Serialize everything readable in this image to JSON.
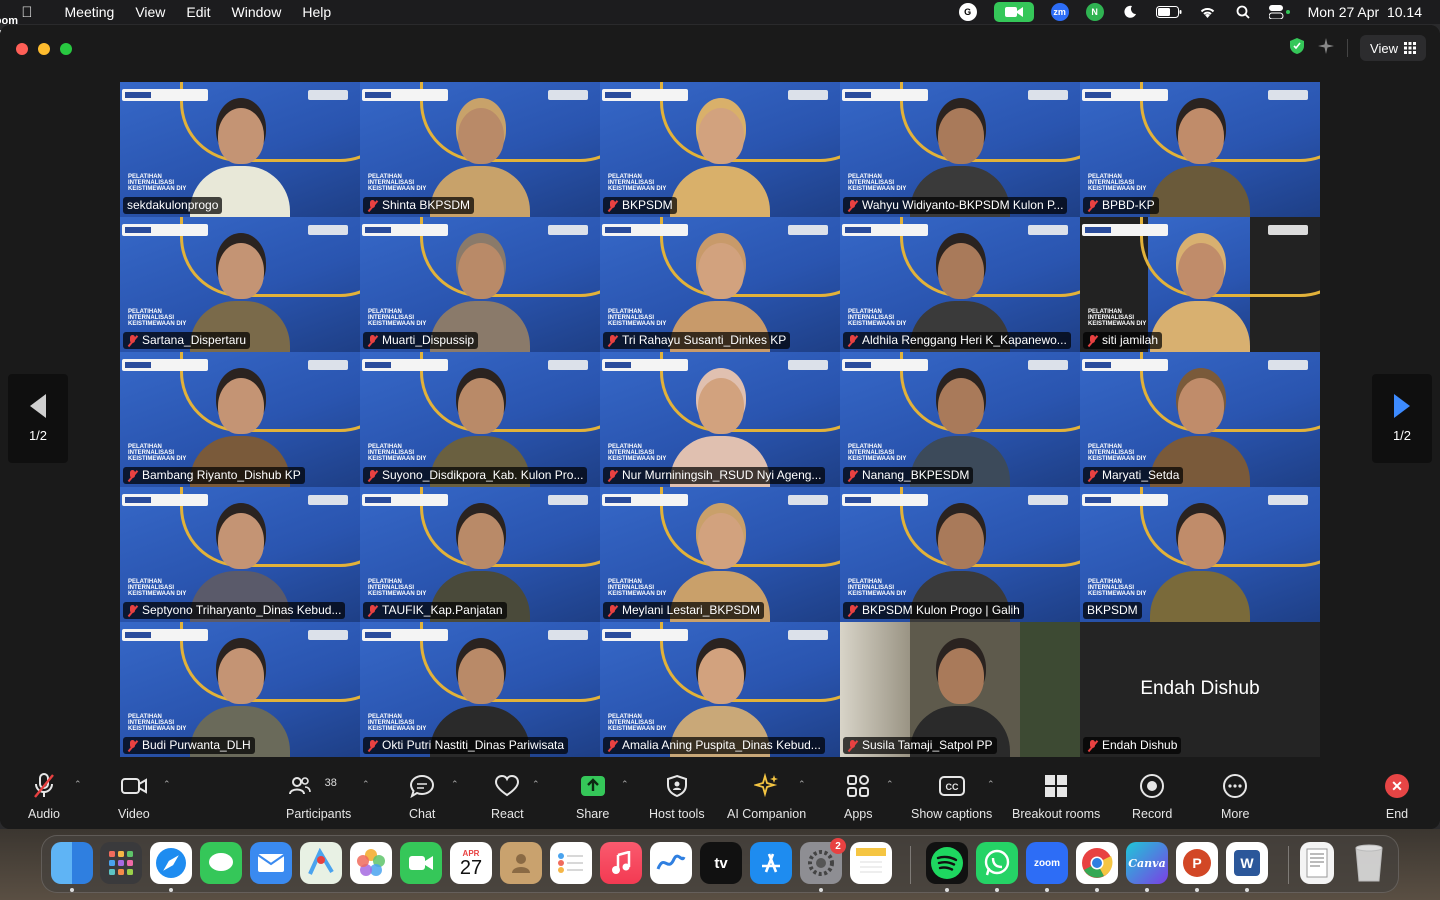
{
  "menubar": {
    "app_name": "Zoom Workplace",
    "menus": [
      "Meeting",
      "View",
      "Edit",
      "Window",
      "Help"
    ],
    "datetime": "Mon 27 Apr  10.14"
  },
  "window": {
    "view_label": "View"
  },
  "slogan": "PELATIHAN INTERNALISASI KEISTIMEWAAN DIY",
  "pager": {
    "left": "1/2",
    "right": "1/2"
  },
  "participants": [
    {
      "name": "sekdakulonprogo",
      "muted": false
    },
    {
      "name": "Shinta BKPSDM",
      "muted": true
    },
    {
      "name": "BKPSDM",
      "muted": true
    },
    {
      "name": "Wahyu Widiyanto-BKPSDM Kulon P...",
      "muted": true
    },
    {
      "name": "BPBD-KP",
      "muted": true
    },
    {
      "name": "Sartana_Dispertaru",
      "muted": true
    },
    {
      "name": "Muarti_Dispussip",
      "muted": true
    },
    {
      "name": "Tri Rahayu Susanti_Dinkes KP",
      "muted": true
    },
    {
      "name": "Aldhila Renggang Heri K_Kapanewo...",
      "muted": true
    },
    {
      "name": "siti jamilah",
      "muted": true
    },
    {
      "name": "Bambang Riyanto_Dishub KP",
      "muted": true
    },
    {
      "name": "Suyono_Disdikpora_Kab. Kulon Pro...",
      "muted": true
    },
    {
      "name": "Nur Murniningsih_RSUD Nyi Ageng...",
      "muted": true
    },
    {
      "name": "Nanang_BKPESDM",
      "muted": true
    },
    {
      "name": "Maryati_Setda",
      "muted": true
    },
    {
      "name": "Septyono Triharyanto_Dinas Kebud...",
      "muted": true
    },
    {
      "name": "TAUFIK_Kap.Panjatan",
      "muted": true
    },
    {
      "name": "Meylani Lestari_BKPSDM",
      "muted": true
    },
    {
      "name": "BKPSDM Kulon Progo | Galih",
      "muted": true
    },
    {
      "name": "BKPSDM",
      "muted": false
    },
    {
      "name": "Budi Purwanta_DLH",
      "muted": true
    },
    {
      "name": "Okti Putri Nastiti_Dinas Pariwisata",
      "muted": true
    },
    {
      "name": "Amalia Aning Puspita_Dinas Kebud...",
      "muted": true
    },
    {
      "name": "Susila Tamaji_Satpol PP",
      "muted": true
    },
    {
      "name": "Endah Dishub",
      "muted": true
    }
  ],
  "no_video_name": "Endah Dishub",
  "toolbar": {
    "audio": "Audio",
    "video": "Video",
    "participants": "Participants",
    "participants_count": "38",
    "chat": "Chat",
    "react": "React",
    "share": "Share",
    "host_tools": "Host tools",
    "ai_companion": "AI Companion",
    "apps": "Apps",
    "captions": "Show captions",
    "breakout": "Breakout rooms",
    "record": "Record",
    "more": "More",
    "end": "End"
  },
  "dock": {
    "calendar_month": "APR",
    "calendar_day": "27",
    "settings_badge": "2",
    "zoom_label": "zoom",
    "canva_label": "Canva",
    "tv_label": "tv",
    "word_label": "W",
    "ppt_label": "P"
  },
  "colors": {
    "accent_green": "#35c759",
    "muted_red": "#e84141",
    "end_red": "#e64545",
    "active_speaker": "#4caf50",
    "tile_blue": "#2a55b0"
  }
}
